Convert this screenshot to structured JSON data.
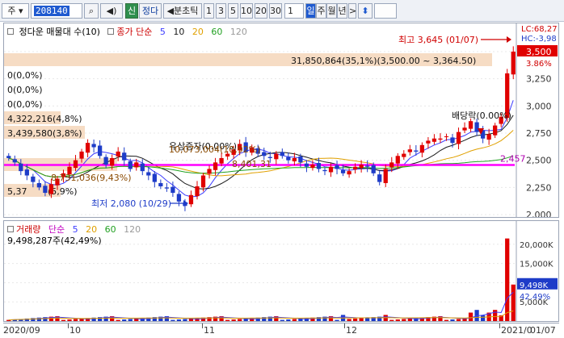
{
  "toolbar": {
    "market_label": "주",
    "code_value": "208140",
    "credit_label": "신",
    "name_label": "정다",
    "period_nav_label": "◀분초틱",
    "periods": [
      "1",
      "3",
      "5",
      "10",
      "20",
      "30"
    ],
    "count_value": "1",
    "unit_selected": "일",
    "units": [
      "주",
      "월",
      "년"
    ],
    "next_label": ">"
  },
  "price_panel": {
    "title": "정다운 매물대 수(10)",
    "ma_label": "종가 단순",
    "ma_periods": [
      "5",
      "10",
      "20",
      "60",
      "120"
    ],
    "ma_colors": [
      "#3b3bff",
      "#1a1a1a",
      "#e0a000",
      "#21a021",
      "#9a9a9a"
    ],
    "corner_lc": "LC:68,27",
    "corner_hc": "HC:-3,98",
    "current_price": "3,500",
    "current_change": "3.86%",
    "high_annotation": "최고 3,645 (01/07)",
    "low_annotation": "최저 2,080 (10/29)",
    "ex_rights": "배당락(0.00%)",
    "capital_reduction": "유상증자(0.00%)",
    "line_price": "2,457",
    "overlay_label": "10,073,004(10,92%)",
    "overlay_mid": "8,731,036(9,43%)",
    "overlay_mid2": "8,401,31",
    "volume_profile": [
      "31,850,864(35,1%)(3,500.00 ~ 3,364.50)",
      "0(0,0%)",
      "0(0,0%)",
      "0(0,0%)",
      "4,322,216(4,8%)",
      "3,439,580(3,8%)",
      "5,37",
      "(5,9%)"
    ],
    "y_ticks": [
      "3,500",
      "3,250",
      "3,000",
      "2,750",
      "2,500",
      "2,250",
      "2,000"
    ]
  },
  "volume_panel": {
    "title": "거래량",
    "ma_label": "단순",
    "ma_periods": [
      "5",
      "20",
      "60",
      "120"
    ],
    "current_volume": "9,498,287주(42,49%)",
    "y_ticks": [
      "20,000K",
      "15,000K",
      "10,000K",
      "5,000K"
    ],
    "current_tag": "9,498K",
    "current_pct": "42.49%"
  },
  "date_axis": {
    "labels": [
      "2020/09",
      "10",
      "11",
      "12",
      "2021/0",
      "01/07"
    ]
  },
  "colors": {
    "up": "#e00000",
    "down": "#1e3cc8",
    "magenta_line": "#ff00ff",
    "volume_profile_fill": "#f6dcc4"
  }
}
